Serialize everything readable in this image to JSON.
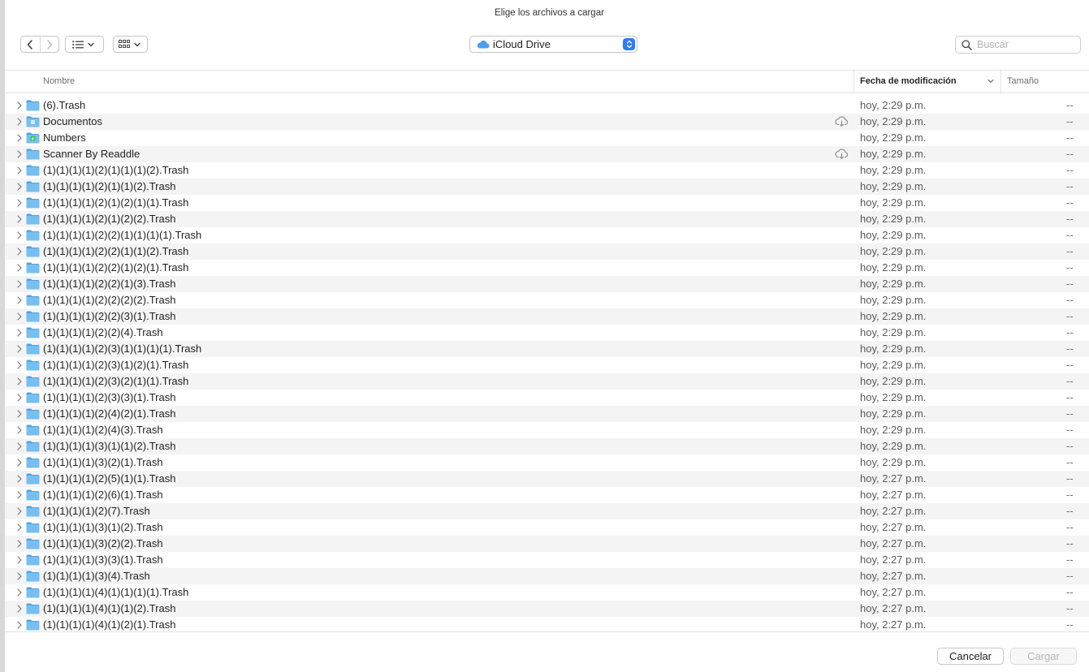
{
  "dialog": {
    "title": "Elige los archivos a cargar"
  },
  "toolbar": {
    "location_label": "iCloud Drive",
    "search_placeholder": "Buscar"
  },
  "columns": {
    "name": "Nombre",
    "date": "Fecha de modificación",
    "size": "Tamaño"
  },
  "rows": [
    {
      "name": "(6).Trash",
      "date": "hoy, 2:29 p.m.",
      "size": "--",
      "icon": "folder-icon",
      "cloud": false
    },
    {
      "name": "Documentos",
      "date": "hoy, 2:29 p.m.",
      "size": "--",
      "icon": "documents-folder-icon",
      "cloud": true
    },
    {
      "name": "Numbers",
      "date": "hoy, 2:29 p.m.",
      "size": "--",
      "icon": "numbers-folder-icon",
      "cloud": false
    },
    {
      "name": "Scanner By Readdle",
      "date": "hoy, 2:29 p.m.",
      "size": "--",
      "icon": "folder-icon",
      "cloud": true
    },
    {
      "name": "(1)(1)(1)(1)(2)(1)(1)(1)(2).Trash",
      "date": "hoy, 2:29 p.m.",
      "size": "--",
      "icon": "folder-icon",
      "cloud": false
    },
    {
      "name": "(1)(1)(1)(1)(2)(1)(1)(2).Trash",
      "date": "hoy, 2:29 p.m.",
      "size": "--",
      "icon": "folder-icon",
      "cloud": false
    },
    {
      "name": "(1)(1)(1)(1)(2)(1)(2)(1)(1).Trash",
      "date": "hoy, 2:29 p.m.",
      "size": "--",
      "icon": "folder-icon",
      "cloud": false
    },
    {
      "name": "(1)(1)(1)(1)(2)(1)(2)(2).Trash",
      "date": "hoy, 2:29 p.m.",
      "size": "--",
      "icon": "folder-icon",
      "cloud": false
    },
    {
      "name": "(1)(1)(1)(1)(2)(2)(1)(1)(1)(1).Trash",
      "date": "hoy, 2:29 p.m.",
      "size": "--",
      "icon": "folder-icon",
      "cloud": false
    },
    {
      "name": "(1)(1)(1)(1)(2)(2)(1)(1)(2).Trash",
      "date": "hoy, 2:29 p.m.",
      "size": "--",
      "icon": "folder-icon",
      "cloud": false
    },
    {
      "name": "(1)(1)(1)(1)(2)(2)(1)(2)(1).Trash",
      "date": "hoy, 2:29 p.m.",
      "size": "--",
      "icon": "folder-icon",
      "cloud": false
    },
    {
      "name": "(1)(1)(1)(1)(2)(2)(1)(3).Trash",
      "date": "hoy, 2:29 p.m.",
      "size": "--",
      "icon": "folder-icon",
      "cloud": false
    },
    {
      "name": "(1)(1)(1)(1)(2)(2)(2)(2).Trash",
      "date": "hoy, 2:29 p.m.",
      "size": "--",
      "icon": "folder-icon",
      "cloud": false
    },
    {
      "name": "(1)(1)(1)(1)(2)(2)(3)(1).Trash",
      "date": "hoy, 2:29 p.m.",
      "size": "--",
      "icon": "folder-icon",
      "cloud": false
    },
    {
      "name": "(1)(1)(1)(1)(2)(2)(4).Trash",
      "date": "hoy, 2:29 p.m.",
      "size": "--",
      "icon": "folder-icon",
      "cloud": false
    },
    {
      "name": "(1)(1)(1)(1)(2)(3)(1)(1)(1)(1).Trash",
      "date": "hoy, 2:29 p.m.",
      "size": "--",
      "icon": "folder-icon",
      "cloud": false
    },
    {
      "name": "(1)(1)(1)(1)(2)(3)(1)(2)(1).Trash",
      "date": "hoy, 2:29 p.m.",
      "size": "--",
      "icon": "folder-icon",
      "cloud": false
    },
    {
      "name": "(1)(1)(1)(1)(2)(3)(2)(1)(1).Trash",
      "date": "hoy, 2:29 p.m.",
      "size": "--",
      "icon": "folder-icon",
      "cloud": false
    },
    {
      "name": "(1)(1)(1)(1)(2)(3)(3)(1).Trash",
      "date": "hoy, 2:29 p.m.",
      "size": "--",
      "icon": "folder-icon",
      "cloud": false
    },
    {
      "name": "(1)(1)(1)(1)(2)(4)(2)(1).Trash",
      "date": "hoy, 2:29 p.m.",
      "size": "--",
      "icon": "folder-icon",
      "cloud": false
    },
    {
      "name": "(1)(1)(1)(1)(2)(4)(3).Trash",
      "date": "hoy, 2:29 p.m.",
      "size": "--",
      "icon": "folder-icon",
      "cloud": false
    },
    {
      "name": "(1)(1)(1)(1)(3)(1)(1)(2).Trash",
      "date": "hoy, 2:29 p.m.",
      "size": "--",
      "icon": "folder-icon",
      "cloud": false
    },
    {
      "name": "(1)(1)(1)(1)(3)(2)(1).Trash",
      "date": "hoy, 2:29 p.m.",
      "size": "--",
      "icon": "folder-icon",
      "cloud": false
    },
    {
      "name": "(1)(1)(1)(1)(2)(5)(1)(1).Trash",
      "date": "hoy, 2:27 p.m.",
      "size": "--",
      "icon": "folder-icon",
      "cloud": false
    },
    {
      "name": "(1)(1)(1)(1)(2)(6)(1).Trash",
      "date": "hoy, 2:27 p.m.",
      "size": "--",
      "icon": "folder-icon",
      "cloud": false
    },
    {
      "name": "(1)(1)(1)(1)(2)(7).Trash",
      "date": "hoy, 2:27 p.m.",
      "size": "--",
      "icon": "folder-icon",
      "cloud": false
    },
    {
      "name": "(1)(1)(1)(1)(3)(1)(2).Trash",
      "date": "hoy, 2:27 p.m.",
      "size": "--",
      "icon": "folder-icon",
      "cloud": false
    },
    {
      "name": "(1)(1)(1)(1)(3)(2)(2).Trash",
      "date": "hoy, 2:27 p.m.",
      "size": "--",
      "icon": "folder-icon",
      "cloud": false
    },
    {
      "name": "(1)(1)(1)(1)(3)(3)(1).Trash",
      "date": "hoy, 2:27 p.m.",
      "size": "--",
      "icon": "folder-icon",
      "cloud": false
    },
    {
      "name": "(1)(1)(1)(1)(3)(4).Trash",
      "date": "hoy, 2:27 p.m.",
      "size": "--",
      "icon": "folder-icon",
      "cloud": false
    },
    {
      "name": "(1)(1)(1)(1)(4)(1)(1)(1)(1).Trash",
      "date": "hoy, 2:27 p.m.",
      "size": "--",
      "icon": "folder-icon",
      "cloud": false
    },
    {
      "name": "(1)(1)(1)(1)(4)(1)(1)(2).Trash",
      "date": "hoy, 2:27 p.m.",
      "size": "--",
      "icon": "folder-icon",
      "cloud": false
    },
    {
      "name": "(1)(1)(1)(1)(4)(1)(2)(1).Trash",
      "date": "hoy, 2:27 p.m.",
      "size": "--",
      "icon": "folder-icon",
      "cloud": false
    }
  ],
  "footer": {
    "cancel_label": "Cancelar",
    "upload_label": "Cargar"
  },
  "colors": {
    "accent": "#2d7cf6",
    "folder": "#5fb0ea",
    "row_alt": "#f4f4f5"
  }
}
